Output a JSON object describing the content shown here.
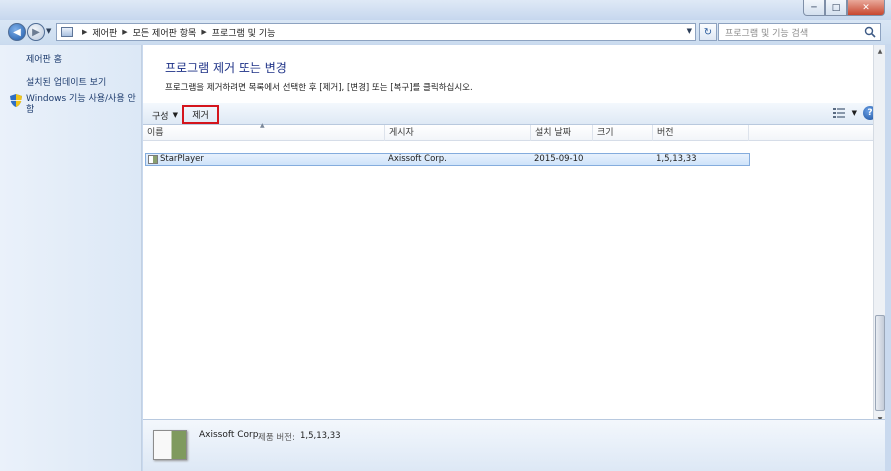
{
  "window": {
    "min_label": "─",
    "max_label": "□",
    "close_label": "✕"
  },
  "address": {
    "crumbs": [
      "제어판",
      "모든 제어판 항목",
      "프로그램 및 기능"
    ],
    "search_placeholder": "프로그램 및 기능 검색"
  },
  "sidebar": {
    "home": "제어판 홈",
    "updates": "설치된 업데이트 보기",
    "features": "Windows 기능 사용/사용 안 함"
  },
  "main": {
    "title": "프로그램 제거 또는 변경",
    "description": "프로그램을 제거하려면 목록에서 선택한 후 [제거], [변경] 또는 [복구]를 클릭하십시오."
  },
  "toolbar": {
    "organize": "구성",
    "remove": "제거"
  },
  "columns": [
    "이름",
    "게시자",
    "설치 날짜",
    "크기",
    "버전"
  ],
  "programs": [
    {
      "name": "StarPlayer",
      "publisher": "Axissoft Corp.",
      "installed": "2015-09-10",
      "size": "",
      "version": "1,5,13,33"
    }
  ],
  "details": {
    "publisher": "Axissoft Corp.",
    "version_label": "제품 버전:",
    "version": "1,5,13,33"
  },
  "icons": [
    "back-icon",
    "forward-icon",
    "control-panel-icon",
    "refresh-icon",
    "search-icon",
    "shield-icon",
    "view-icon",
    "help-icon",
    "program-icon"
  ]
}
